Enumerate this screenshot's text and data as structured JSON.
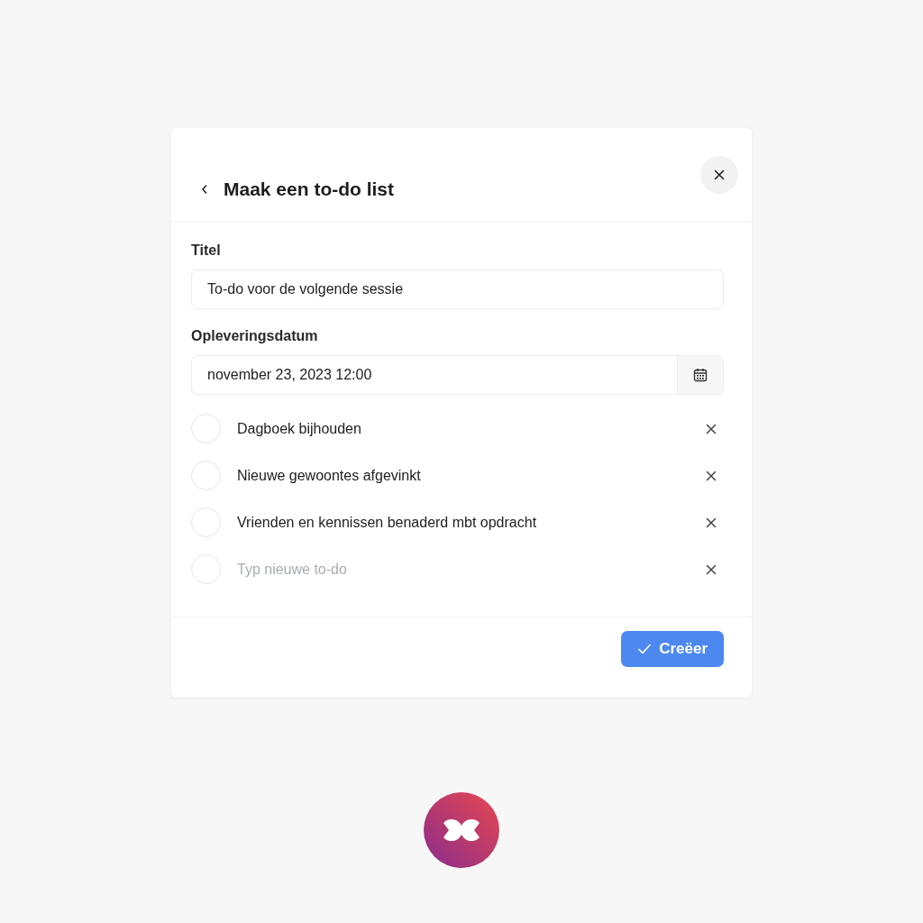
{
  "dialog": {
    "title": "Maak een to-do list"
  },
  "fields": [
    {
      "label": "Titel",
      "value": "To-do voor de volgende sessie"
    },
    {
      "label": "Opleveringsdatum",
      "value": "november 23, 2023 12:00",
      "kind": "date"
    }
  ],
  "todos": [
    {
      "text": "Dagboek bijhouden",
      "checked": false
    },
    {
      "text": "Nieuwe gewoontes afgevinkt",
      "checked": false
    },
    {
      "text": "Vrienden en kennissen benaderd mbt opdracht",
      "checked": false
    }
  ],
  "new_todo": {
    "placeholder": "Typ nieuwe to-do",
    "checked": false
  },
  "buttons": [
    {
      "label": "Creëer",
      "kind": "primary"
    }
  ]
}
